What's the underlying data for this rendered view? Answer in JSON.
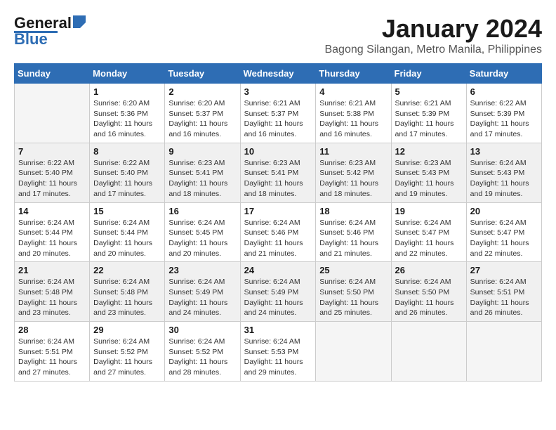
{
  "header": {
    "logo": {
      "line1": "General",
      "line2": "Blue"
    },
    "title": "January 2024",
    "subtitle": "Bagong Silangan, Metro Manila, Philippines"
  },
  "days_of_week": [
    "Sunday",
    "Monday",
    "Tuesday",
    "Wednesday",
    "Thursday",
    "Friday",
    "Saturday"
  ],
  "weeks": [
    [
      {
        "num": "",
        "sunrise": "",
        "sunset": "",
        "daylight": "",
        "empty": true
      },
      {
        "num": "1",
        "sunrise": "Sunrise: 6:20 AM",
        "sunset": "Sunset: 5:36 PM",
        "daylight": "Daylight: 11 hours and 16 minutes."
      },
      {
        "num": "2",
        "sunrise": "Sunrise: 6:20 AM",
        "sunset": "Sunset: 5:37 PM",
        "daylight": "Daylight: 11 hours and 16 minutes."
      },
      {
        "num": "3",
        "sunrise": "Sunrise: 6:21 AM",
        "sunset": "Sunset: 5:37 PM",
        "daylight": "Daylight: 11 hours and 16 minutes."
      },
      {
        "num": "4",
        "sunrise": "Sunrise: 6:21 AM",
        "sunset": "Sunset: 5:38 PM",
        "daylight": "Daylight: 11 hours and 16 minutes."
      },
      {
        "num": "5",
        "sunrise": "Sunrise: 6:21 AM",
        "sunset": "Sunset: 5:39 PM",
        "daylight": "Daylight: 11 hours and 17 minutes."
      },
      {
        "num": "6",
        "sunrise": "Sunrise: 6:22 AM",
        "sunset": "Sunset: 5:39 PM",
        "daylight": "Daylight: 11 hours and 17 minutes."
      }
    ],
    [
      {
        "num": "7",
        "sunrise": "Sunrise: 6:22 AM",
        "sunset": "Sunset: 5:40 PM",
        "daylight": "Daylight: 11 hours and 17 minutes."
      },
      {
        "num": "8",
        "sunrise": "Sunrise: 6:22 AM",
        "sunset": "Sunset: 5:40 PM",
        "daylight": "Daylight: 11 hours and 17 minutes."
      },
      {
        "num": "9",
        "sunrise": "Sunrise: 6:23 AM",
        "sunset": "Sunset: 5:41 PM",
        "daylight": "Daylight: 11 hours and 18 minutes."
      },
      {
        "num": "10",
        "sunrise": "Sunrise: 6:23 AM",
        "sunset": "Sunset: 5:41 PM",
        "daylight": "Daylight: 11 hours and 18 minutes."
      },
      {
        "num": "11",
        "sunrise": "Sunrise: 6:23 AM",
        "sunset": "Sunset: 5:42 PM",
        "daylight": "Daylight: 11 hours and 18 minutes."
      },
      {
        "num": "12",
        "sunrise": "Sunrise: 6:23 AM",
        "sunset": "Sunset: 5:43 PM",
        "daylight": "Daylight: 11 hours and 19 minutes."
      },
      {
        "num": "13",
        "sunrise": "Sunrise: 6:24 AM",
        "sunset": "Sunset: 5:43 PM",
        "daylight": "Daylight: 11 hours and 19 minutes."
      }
    ],
    [
      {
        "num": "14",
        "sunrise": "Sunrise: 6:24 AM",
        "sunset": "Sunset: 5:44 PM",
        "daylight": "Daylight: 11 hours and 20 minutes."
      },
      {
        "num": "15",
        "sunrise": "Sunrise: 6:24 AM",
        "sunset": "Sunset: 5:44 PM",
        "daylight": "Daylight: 11 hours and 20 minutes."
      },
      {
        "num": "16",
        "sunrise": "Sunrise: 6:24 AM",
        "sunset": "Sunset: 5:45 PM",
        "daylight": "Daylight: 11 hours and 20 minutes."
      },
      {
        "num": "17",
        "sunrise": "Sunrise: 6:24 AM",
        "sunset": "Sunset: 5:46 PM",
        "daylight": "Daylight: 11 hours and 21 minutes."
      },
      {
        "num": "18",
        "sunrise": "Sunrise: 6:24 AM",
        "sunset": "Sunset: 5:46 PM",
        "daylight": "Daylight: 11 hours and 21 minutes."
      },
      {
        "num": "19",
        "sunrise": "Sunrise: 6:24 AM",
        "sunset": "Sunset: 5:47 PM",
        "daylight": "Daylight: 11 hours and 22 minutes."
      },
      {
        "num": "20",
        "sunrise": "Sunrise: 6:24 AM",
        "sunset": "Sunset: 5:47 PM",
        "daylight": "Daylight: 11 hours and 22 minutes."
      }
    ],
    [
      {
        "num": "21",
        "sunrise": "Sunrise: 6:24 AM",
        "sunset": "Sunset: 5:48 PM",
        "daylight": "Daylight: 11 hours and 23 minutes."
      },
      {
        "num": "22",
        "sunrise": "Sunrise: 6:24 AM",
        "sunset": "Sunset: 5:48 PM",
        "daylight": "Daylight: 11 hours and 23 minutes."
      },
      {
        "num": "23",
        "sunrise": "Sunrise: 6:24 AM",
        "sunset": "Sunset: 5:49 PM",
        "daylight": "Daylight: 11 hours and 24 minutes."
      },
      {
        "num": "24",
        "sunrise": "Sunrise: 6:24 AM",
        "sunset": "Sunset: 5:49 PM",
        "daylight": "Daylight: 11 hours and 24 minutes."
      },
      {
        "num": "25",
        "sunrise": "Sunrise: 6:24 AM",
        "sunset": "Sunset: 5:50 PM",
        "daylight": "Daylight: 11 hours and 25 minutes."
      },
      {
        "num": "26",
        "sunrise": "Sunrise: 6:24 AM",
        "sunset": "Sunset: 5:50 PM",
        "daylight": "Daylight: 11 hours and 26 minutes."
      },
      {
        "num": "27",
        "sunrise": "Sunrise: 6:24 AM",
        "sunset": "Sunset: 5:51 PM",
        "daylight": "Daylight: 11 hours and 26 minutes."
      }
    ],
    [
      {
        "num": "28",
        "sunrise": "Sunrise: 6:24 AM",
        "sunset": "Sunset: 5:51 PM",
        "daylight": "Daylight: 11 hours and 27 minutes."
      },
      {
        "num": "29",
        "sunrise": "Sunrise: 6:24 AM",
        "sunset": "Sunset: 5:52 PM",
        "daylight": "Daylight: 11 hours and 27 minutes."
      },
      {
        "num": "30",
        "sunrise": "Sunrise: 6:24 AM",
        "sunset": "Sunset: 5:52 PM",
        "daylight": "Daylight: 11 hours and 28 minutes."
      },
      {
        "num": "31",
        "sunrise": "Sunrise: 6:24 AM",
        "sunset": "Sunset: 5:53 PM",
        "daylight": "Daylight: 11 hours and 29 minutes."
      },
      {
        "num": "",
        "sunrise": "",
        "sunset": "",
        "daylight": "",
        "empty": true
      },
      {
        "num": "",
        "sunrise": "",
        "sunset": "",
        "daylight": "",
        "empty": true
      },
      {
        "num": "",
        "sunrise": "",
        "sunset": "",
        "daylight": "",
        "empty": true
      }
    ]
  ]
}
